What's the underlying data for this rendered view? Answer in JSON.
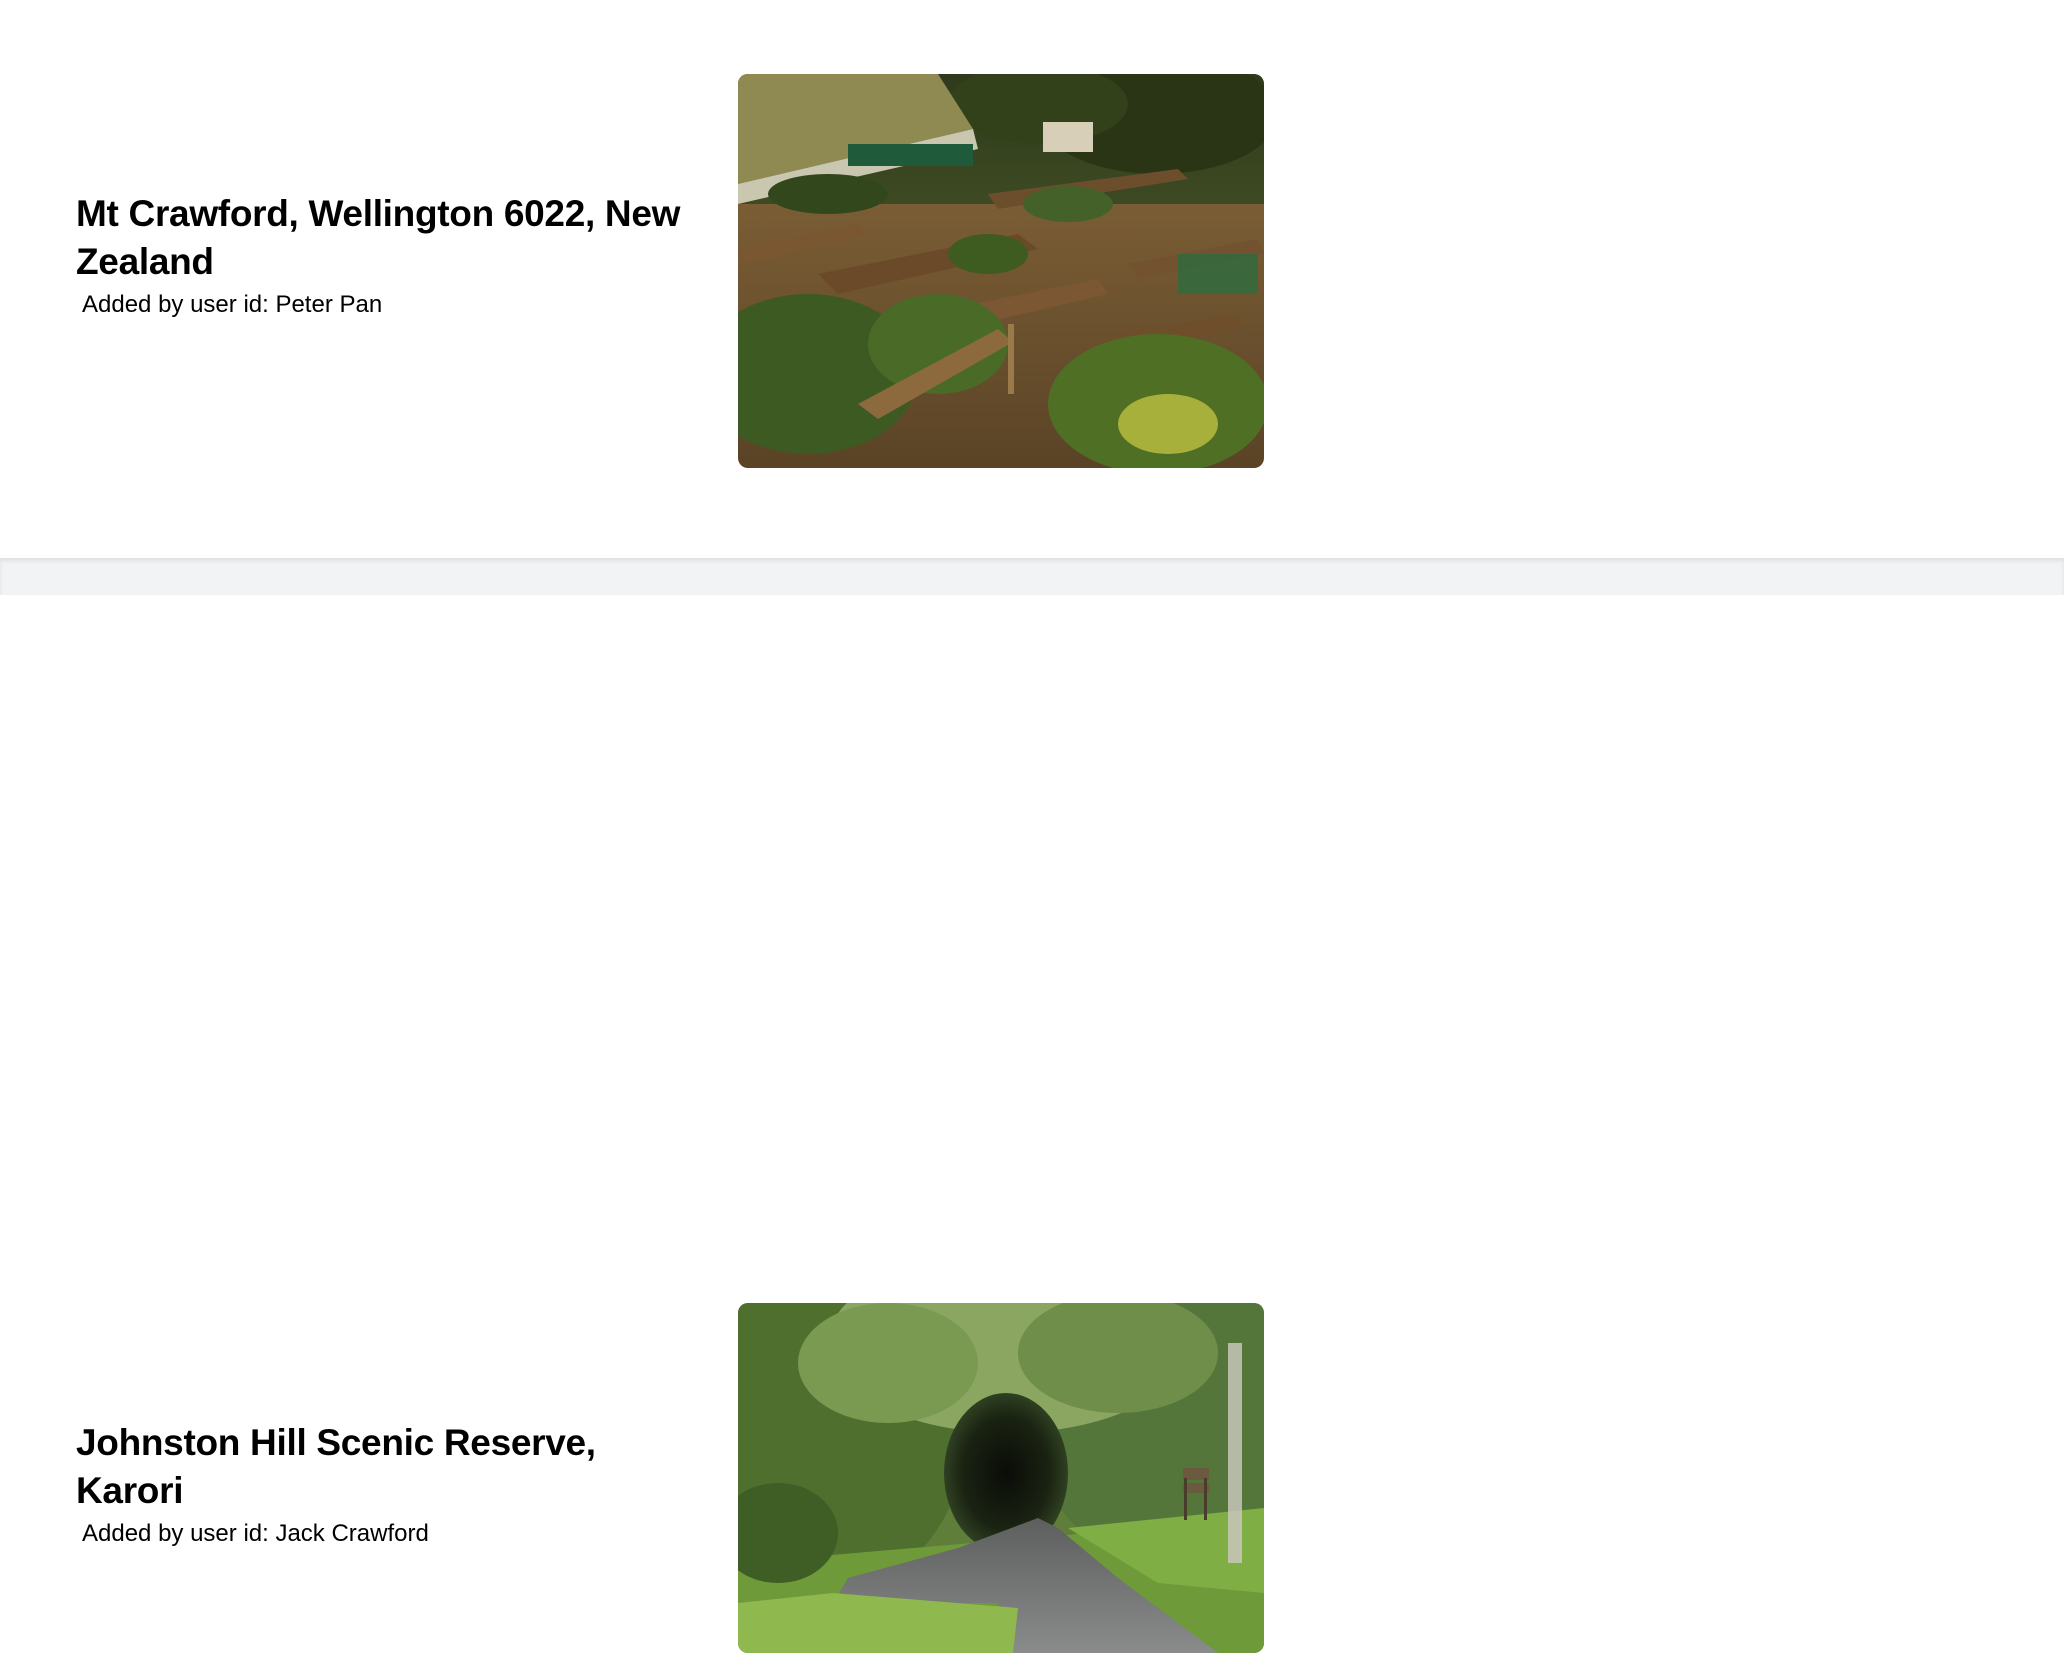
{
  "entries": [
    {
      "title": "Mt Crawford, Wellington 6022, New Zealand",
      "byline": "Added by user id: Peter Pan",
      "image_subject": "community-garden-raised-beds"
    },
    {
      "title": "Johnston Hill Scenic Reserve, Karori",
      "byline": "Added by user id: Jack Crawford",
      "image_subject": "forest-road-tunnel"
    }
  ],
  "colors": {
    "background": "#ffffff",
    "divider": "#f2f3f4",
    "text": "#000000"
  }
}
